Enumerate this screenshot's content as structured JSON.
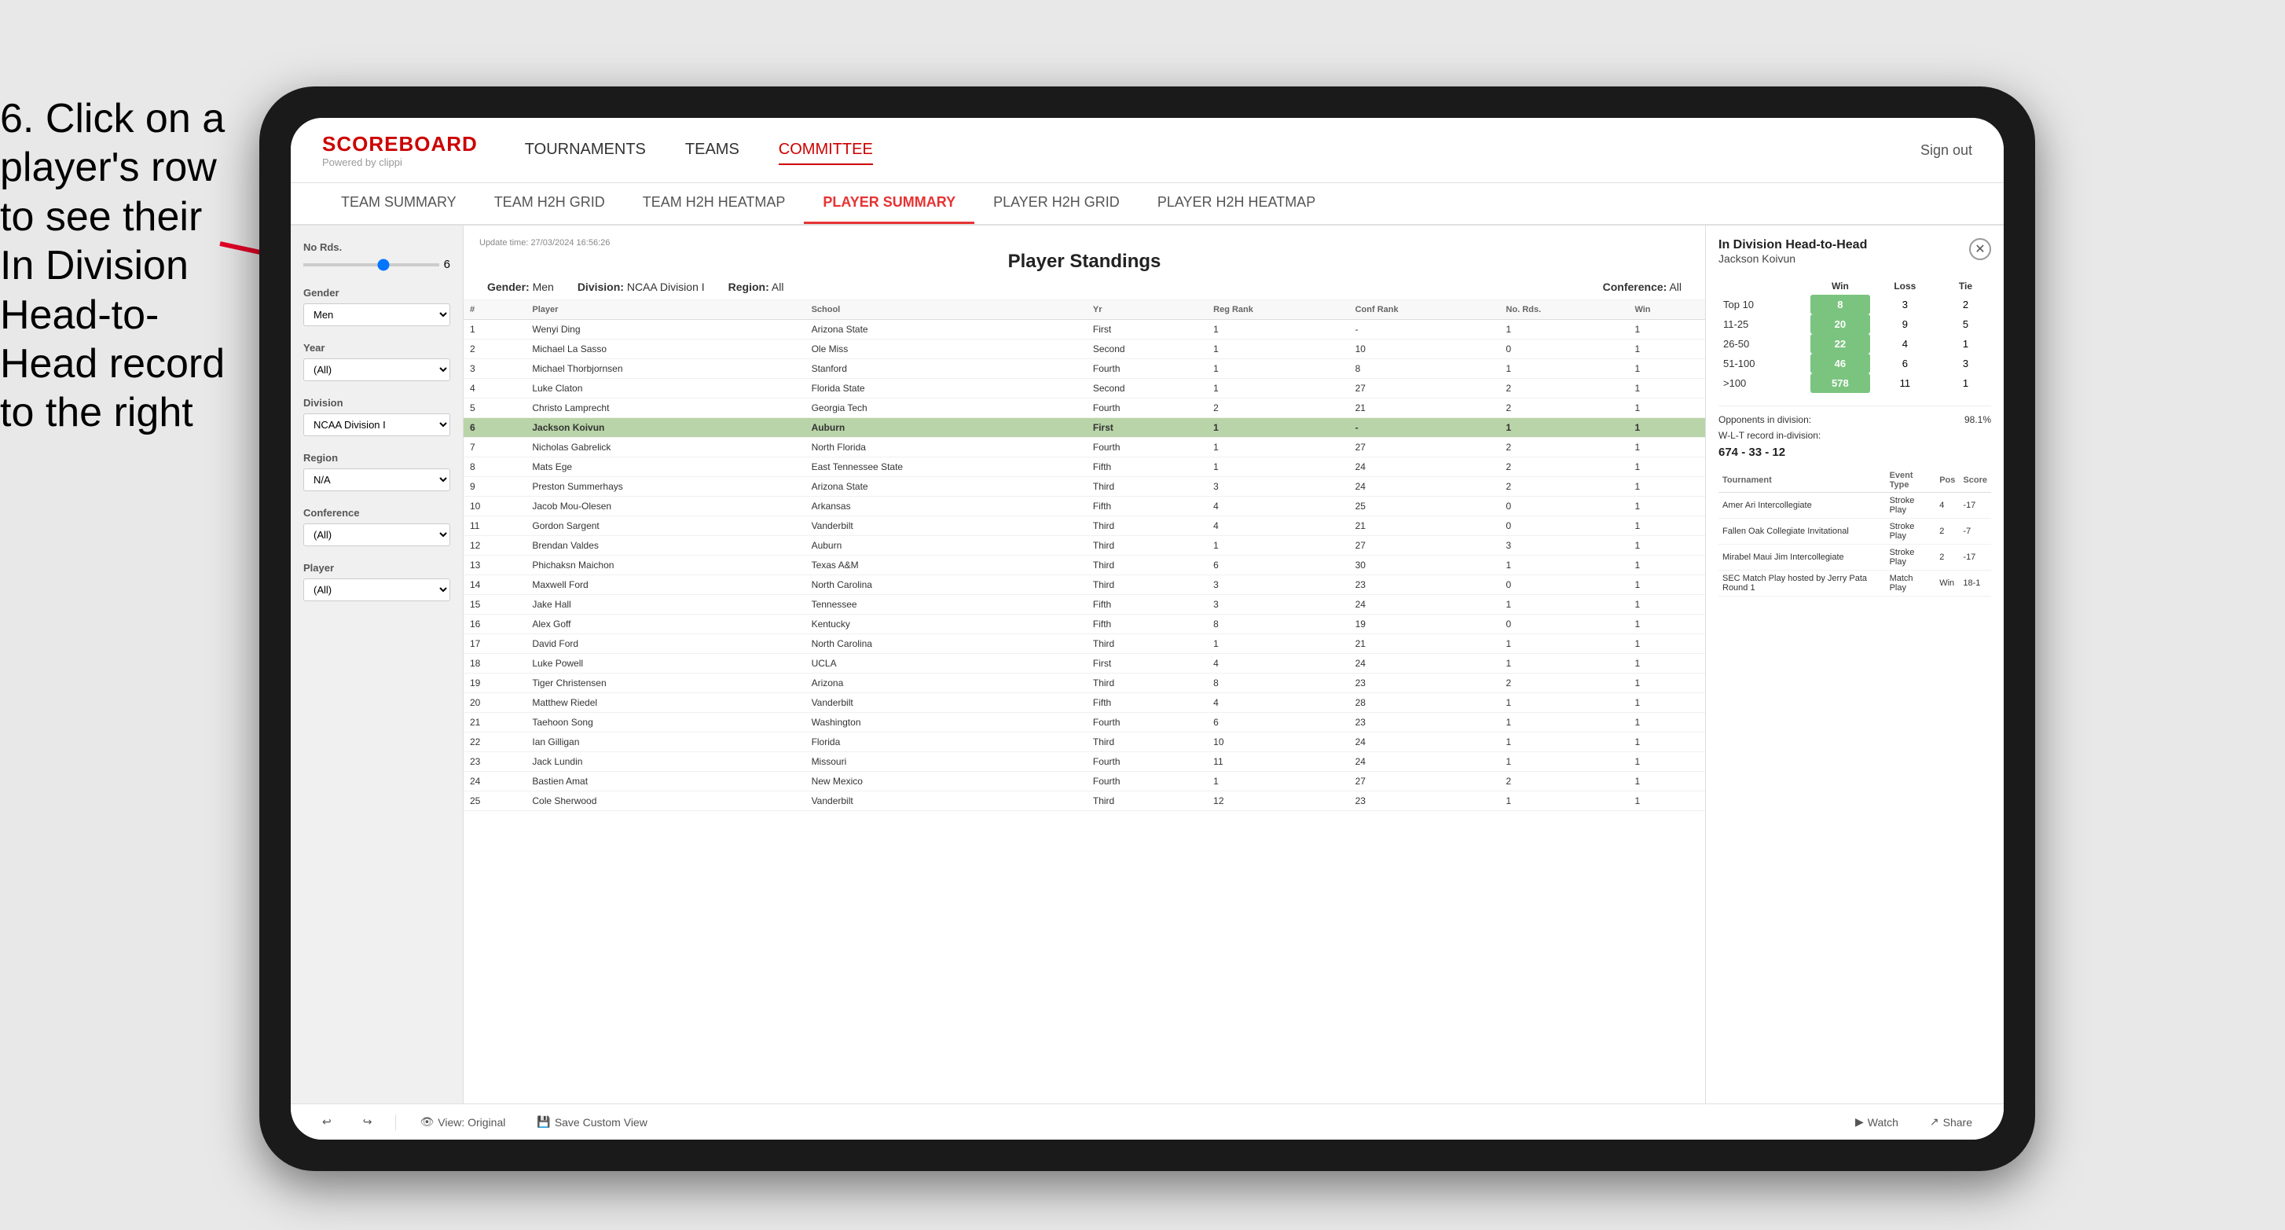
{
  "instruction": {
    "text": "6. Click on a player's row to see their In Division Head-to-Head record to the right"
  },
  "nav": {
    "logo": "SCOREBOARD",
    "logo_sub": "Powered by clippi",
    "items": [
      "TOURNAMENTS",
      "TEAMS",
      "COMMITTEE"
    ],
    "sign_out": "Sign out"
  },
  "sub_nav": {
    "items": [
      "TEAM SUMMARY",
      "TEAM H2H GRID",
      "TEAM H2H HEATMAP",
      "PLAYER SUMMARY",
      "PLAYER H2H GRID",
      "PLAYER H2H HEATMAP"
    ]
  },
  "sidebar": {
    "no_rds_label": "No Rds.",
    "no_rds_value": "6",
    "gender_label": "Gender",
    "gender_value": "Men",
    "year_label": "Year",
    "year_value": "(All)",
    "division_label": "Division",
    "division_value": "NCAA Division I",
    "region_label": "Region",
    "region_value": "N/A",
    "conference_label": "Conference",
    "conference_value": "(All)",
    "player_label": "Player",
    "player_value": "(All)"
  },
  "standings": {
    "update_time": "Update time:",
    "update_date": "27/03/2024 16:56:26",
    "title": "Player Standings",
    "gender_label": "Gender:",
    "gender_value": "Men",
    "division_label": "Division:",
    "division_value": "NCAA Division I",
    "region_label": "Region:",
    "region_value": "All",
    "conference_label": "Conference:",
    "conference_value": "All",
    "columns": [
      "#",
      "Player",
      "School",
      "Yr",
      "Reg Rank",
      "Conf Rank",
      "No. Rds.",
      "Win"
    ],
    "rows": [
      {
        "num": "1",
        "player": "Wenyi Ding",
        "school": "Arizona State",
        "yr": "First",
        "reg": "1",
        "conf": "-",
        "rds": "1",
        "win": "1"
      },
      {
        "num": "2",
        "player": "Michael La Sasso",
        "school": "Ole Miss",
        "yr": "Second",
        "reg": "1",
        "conf": "10",
        "rds": "0",
        "win": "1"
      },
      {
        "num": "3",
        "player": "Michael Thorbjornsen",
        "school": "Stanford",
        "yr": "Fourth",
        "reg": "1",
        "conf": "8",
        "rds": "1",
        "win": "1"
      },
      {
        "num": "4",
        "player": "Luke Claton",
        "school": "Florida State",
        "yr": "Second",
        "reg": "1",
        "conf": "27",
        "rds": "2",
        "win": "1"
      },
      {
        "num": "5",
        "player": "Christo Lamprecht",
        "school": "Georgia Tech",
        "yr": "Fourth",
        "reg": "2",
        "conf": "21",
        "rds": "2",
        "win": "1"
      },
      {
        "num": "6",
        "player": "Jackson Koivun",
        "school": "Auburn",
        "yr": "First",
        "reg": "1",
        "conf": "-",
        "rds": "1",
        "win": "1"
      },
      {
        "num": "7",
        "player": "Nicholas Gabrelick",
        "school": "North Florida",
        "yr": "Fourth",
        "reg": "1",
        "conf": "27",
        "rds": "2",
        "win": "1"
      },
      {
        "num": "8",
        "player": "Mats Ege",
        "school": "East Tennessee State",
        "yr": "Fifth",
        "reg": "1",
        "conf": "24",
        "rds": "2",
        "win": "1"
      },
      {
        "num": "9",
        "player": "Preston Summerhays",
        "school": "Arizona State",
        "yr": "Third",
        "reg": "3",
        "conf": "24",
        "rds": "2",
        "win": "1"
      },
      {
        "num": "10",
        "player": "Jacob Mou-Olesen",
        "school": "Arkansas",
        "yr": "Fifth",
        "reg": "4",
        "conf": "25",
        "rds": "0",
        "win": "1"
      },
      {
        "num": "11",
        "player": "Gordon Sargent",
        "school": "Vanderbilt",
        "yr": "Third",
        "reg": "4",
        "conf": "21",
        "rds": "0",
        "win": "1"
      },
      {
        "num": "12",
        "player": "Brendan Valdes",
        "school": "Auburn",
        "yr": "Third",
        "reg": "1",
        "conf": "27",
        "rds": "3",
        "win": "1"
      },
      {
        "num": "13",
        "player": "Phichaksn Maichon",
        "school": "Texas A&M",
        "yr": "Third",
        "reg": "6",
        "conf": "30",
        "rds": "1",
        "win": "1"
      },
      {
        "num": "14",
        "player": "Maxwell Ford",
        "school": "North Carolina",
        "yr": "Third",
        "reg": "3",
        "conf": "23",
        "rds": "0",
        "win": "1"
      },
      {
        "num": "15",
        "player": "Jake Hall",
        "school": "Tennessee",
        "yr": "Fifth",
        "reg": "3",
        "conf": "24",
        "rds": "1",
        "win": "1"
      },
      {
        "num": "16",
        "player": "Alex Goff",
        "school": "Kentucky",
        "yr": "Fifth",
        "reg": "8",
        "conf": "19",
        "rds": "0",
        "win": "1"
      },
      {
        "num": "17",
        "player": "David Ford",
        "school": "North Carolina",
        "yr": "Third",
        "reg": "1",
        "conf": "21",
        "rds": "1",
        "win": "1"
      },
      {
        "num": "18",
        "player": "Luke Powell",
        "school": "UCLA",
        "yr": "First",
        "reg": "4",
        "conf": "24",
        "rds": "1",
        "win": "1"
      },
      {
        "num": "19",
        "player": "Tiger Christensen",
        "school": "Arizona",
        "yr": "Third",
        "reg": "8",
        "conf": "23",
        "rds": "2",
        "win": "1"
      },
      {
        "num": "20",
        "player": "Matthew Riedel",
        "school": "Vanderbilt",
        "yr": "Fifth",
        "reg": "4",
        "conf": "28",
        "rds": "1",
        "win": "1"
      },
      {
        "num": "21",
        "player": "Taehoon Song",
        "school": "Washington",
        "yr": "Fourth",
        "reg": "6",
        "conf": "23",
        "rds": "1",
        "win": "1"
      },
      {
        "num": "22",
        "player": "Ian Gilligan",
        "school": "Florida",
        "yr": "Third",
        "reg": "10",
        "conf": "24",
        "rds": "1",
        "win": "1"
      },
      {
        "num": "23",
        "player": "Jack Lundin",
        "school": "Missouri",
        "yr": "Fourth",
        "reg": "11",
        "conf": "24",
        "rds": "1",
        "win": "1"
      },
      {
        "num": "24",
        "player": "Bastien Amat",
        "school": "New Mexico",
        "yr": "Fourth",
        "reg": "1",
        "conf": "27",
        "rds": "2",
        "win": "1"
      },
      {
        "num": "25",
        "player": "Cole Sherwood",
        "school": "Vanderbilt",
        "yr": "Third",
        "reg": "12",
        "conf": "23",
        "rds": "1",
        "win": "1"
      }
    ]
  },
  "h2h": {
    "title": "In Division Head-to-Head",
    "player_name": "Jackson Koivun",
    "table_headers": [
      "",
      "Win",
      "Loss",
      "Tie"
    ],
    "rows": [
      {
        "range": "Top 10",
        "win": "8",
        "loss": "3",
        "tie": "2",
        "win_highlight": true
      },
      {
        "range": "11-25",
        "win": "20",
        "loss": "9",
        "tie": "5",
        "win_highlight": true
      },
      {
        "range": "26-50",
        "win": "22",
        "loss": "4",
        "tie": "1",
        "win_highlight": true
      },
      {
        "range": "51-100",
        "win": "46",
        "loss": "6",
        "tie": "3",
        "win_highlight": true
      },
      {
        "range": ">100",
        "win": "578",
        "loss": "11",
        "tie": "1",
        "win_highlight": true
      }
    ],
    "opp_label": "Opponents in division:",
    "opp_value": "98.1%",
    "wlt_label": "W-L-T record in-division:",
    "wlt_value": "674 - 33 - 12",
    "tournament_columns": [
      "Tournament",
      "Event Type",
      "Pos",
      "Score"
    ],
    "tournaments": [
      {
        "name": "Amer Ari Intercollegiate",
        "type": "Stroke Play",
        "pos": "4",
        "score": "-17"
      },
      {
        "name": "Fallen Oak Collegiate Invitational",
        "type": "Stroke Play",
        "pos": "2",
        "score": "-7"
      },
      {
        "name": "Mirabel Maui Jim Intercollegiate",
        "type": "Stroke Play",
        "pos": "2",
        "score": "-17"
      },
      {
        "name": "SEC Match Play hosted by Jerry Pata Round 1",
        "type": "Match Play",
        "pos": "Win",
        "score": "18-1"
      }
    ]
  },
  "toolbar": {
    "view_original": "View: Original",
    "save_custom": "Save Custom View",
    "watch": "Watch",
    "share": "Share"
  }
}
